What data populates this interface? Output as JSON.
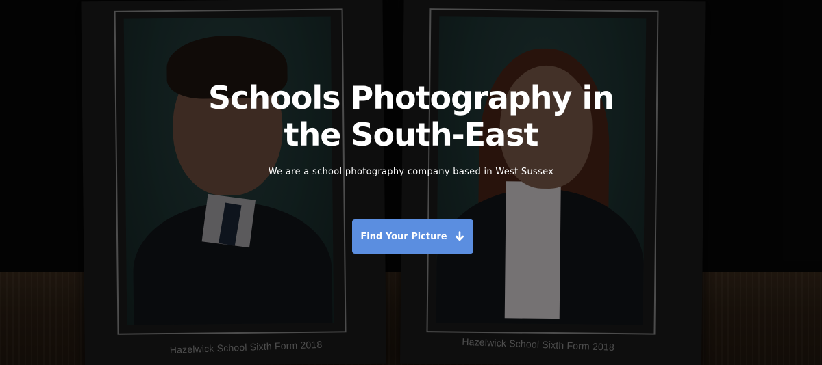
{
  "hero": {
    "title_line_1": "Schools Photography in",
    "title_line_2": "the South-East",
    "subtitle": "We are a school photography company based in West Sussex",
    "cta_label": "Find Your Picture",
    "cta_icon": "arrow-down-icon",
    "cta_color": "#5b8ee0"
  },
  "background": {
    "left_card_caption": "Hazelwick School Sixth Form 2018",
    "right_card_caption": "Hazelwick School Sixth Form 2018"
  }
}
